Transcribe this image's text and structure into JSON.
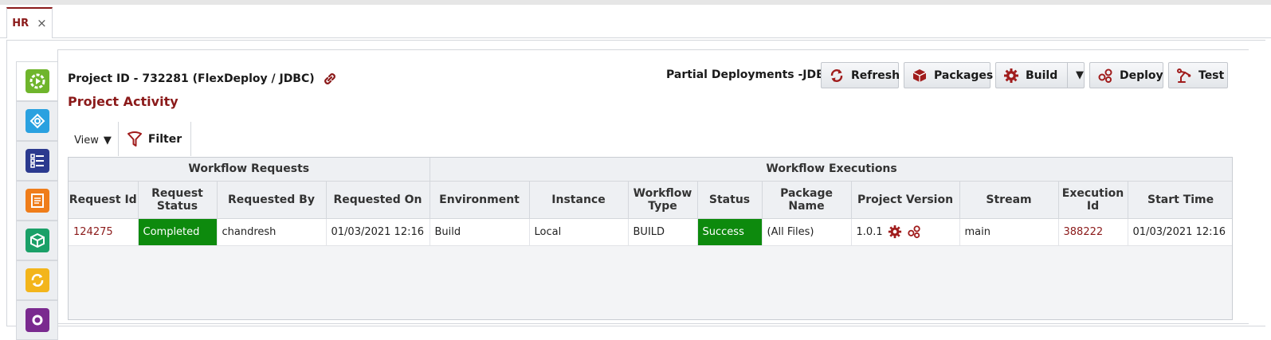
{
  "tabs": [
    {
      "label": "HR",
      "close": "×"
    }
  ],
  "header": {
    "project_title": "Project ID - 732281 (FlexDeploy / JDBC)",
    "section_title": "Project Activity",
    "partial_label": "Partial Deployments -JDBC"
  },
  "toolbar": {
    "refresh": "Refresh",
    "packages": "Packages",
    "build": "Build",
    "build_menu": "▼",
    "deploy": "Deploy",
    "test": "Test"
  },
  "viewbar": {
    "view": "View",
    "view_menu": "▼",
    "filter": "Filter"
  },
  "sidenav": {
    "items": [
      {
        "icon": "workflow-play-icon",
        "color": "#6fb52c"
      },
      {
        "icon": "integration-icon",
        "color": "#2aa1e0"
      },
      {
        "icon": "checklist-icon",
        "color": "#2b3a8f"
      },
      {
        "icon": "document-icon",
        "color": "#ef7d1a"
      },
      {
        "icon": "package-icon",
        "color": "#1aa068"
      },
      {
        "icon": "refresh-icon",
        "color": "#f3b51b"
      },
      {
        "icon": "build-icon",
        "color": "#7a2a8f"
      }
    ]
  },
  "table": {
    "groups": [
      "Workflow Requests",
      "Workflow Executions"
    ],
    "columns": {
      "request_id": "Request Id",
      "request_status": "Request Status",
      "requested_by": "Requested By",
      "requested_on": "Requested On",
      "environment": "Environment",
      "instance": "Instance",
      "workflow_type": "Workflow Type",
      "status": "Status",
      "package_name": "Package Name",
      "project_version": "Project Version",
      "stream": "Stream",
      "execution_id": "Execution Id",
      "start_time": "Start Time"
    },
    "rows": [
      {
        "request_id": "124275",
        "request_status": "Completed",
        "requested_by": "chandresh",
        "requested_on": "01/03/2021 12:16",
        "environment": "Build",
        "instance": "Local",
        "workflow_type": "BUILD",
        "status": "Success",
        "package_name": "(All Files)",
        "project_version": "1.0.1",
        "stream": "main",
        "execution_id": "388222",
        "start_time": "01/03/2021 12:16"
      }
    ]
  },
  "colors": {
    "brand": "#8b1a1a",
    "success": "#0d8a0d"
  }
}
